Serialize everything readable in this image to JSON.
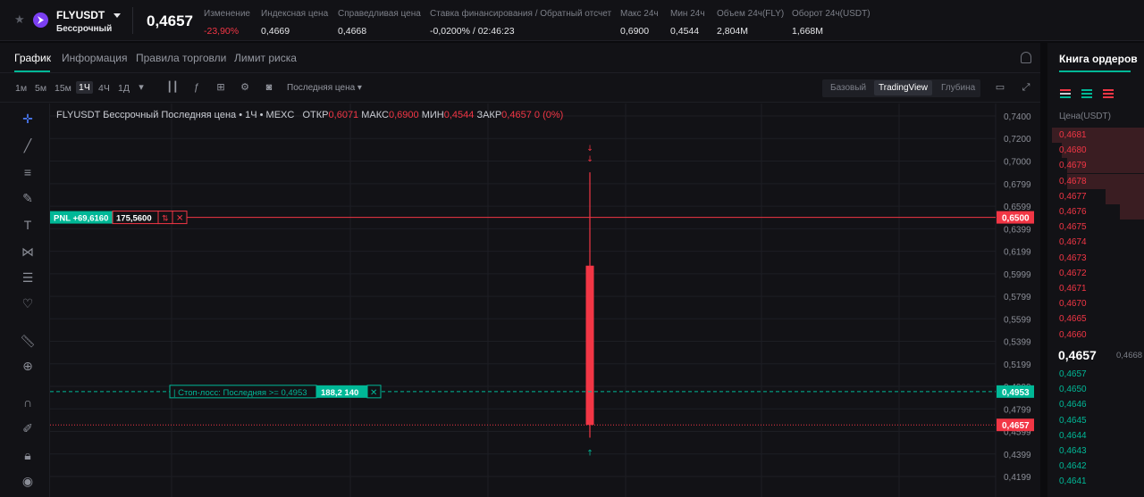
{
  "ticker": {
    "symbol": "FLYUSDT",
    "type": "Бессрочный",
    "last_price": "0,4657",
    "stats": [
      {
        "label": "Изменение",
        "value": "-23,90%",
        "color": "red"
      },
      {
        "label": "Индексная цена",
        "value": "0,4669"
      },
      {
        "label": "Справедливая цена",
        "value": "0,4668"
      },
      {
        "label": "Ставка финансирования / Обратный отсчет",
        "value": "-0,0200% / 02:46:23"
      },
      {
        "label": "Макс 24ч",
        "value": "0,6900"
      },
      {
        "label": "Мин 24ч",
        "value": "0,4544"
      },
      {
        "label": "Объем 24ч(FLY)",
        "value": "2,804M"
      },
      {
        "label": "Оборот 24ч(USDT)",
        "value": "1,668M"
      }
    ]
  },
  "tabs": [
    "График",
    "Информация",
    "Правила торговли",
    "Лимит риска"
  ],
  "toolbar": {
    "timeframes": [
      "1м",
      "5м",
      "15м",
      "1Ч",
      "4Ч",
      "1Д"
    ],
    "active_timeframe": "1Ч",
    "price_source": "Последняя цена",
    "views": [
      "Базовый",
      "TradingView",
      "Глубина"
    ],
    "active_view": "TradingView"
  },
  "legend": {
    "title": "FLYUSDT Бессрочный Последняя цена • 1Ч • MEXC",
    "open_label": "ОТКР",
    "open": "0,6071",
    "high_label": "МАКС",
    "high": "0,6900",
    "low_label": "МИН",
    "low": "0,4544",
    "close_label": "ЗАКР",
    "close": "0,4657",
    "change": "0 (0%)"
  },
  "chart_data": {
    "type": "candlestick",
    "ylim": [
      0.41,
      0.745
    ],
    "y_ticks": [
      "0,7400",
      "0,7200",
      "0,7000",
      "0,6799",
      "0,6599",
      "0,6399",
      "0,6199",
      "0,5999",
      "0,5799",
      "0,5599",
      "0,5399",
      "0,5199",
      "0,4999",
      "0,4799",
      "0,4599",
      "0,4399",
      "0,4199"
    ],
    "y_tick_values": [
      0.74,
      0.72,
      0.7,
      0.6799,
      0.6599,
      0.6399,
      0.6199,
      0.5999,
      0.5799,
      0.5599,
      0.5399,
      0.5199,
      0.4999,
      0.4799,
      0.4599,
      0.4399,
      0.4199
    ],
    "candles": [
      {
        "open": 0.6071,
        "high": 0.69,
        "low": 0.4544,
        "close": 0.4657
      }
    ],
    "price_lines": [
      {
        "name": "position",
        "value": 0.65,
        "label": "0,6500",
        "color": "#f23645"
      },
      {
        "name": "stop-loss",
        "value": 0.4953,
        "label": "0,4953",
        "color": "#00b897"
      },
      {
        "name": "last",
        "value": 0.4657,
        "label": "0,4657",
        "color": "#f23645"
      }
    ],
    "position": {
      "pnl": "PNL +69,6160",
      "qty": "175,5600"
    },
    "stop_loss": {
      "label": "Стоп-лосс: Последняя >= 0,4953",
      "qty": "188,2 140"
    }
  },
  "orderbook": {
    "title": "Книга ордеров",
    "column": "Цена(USDT)",
    "asks": [
      {
        "price": "0,4681",
        "depth": 0.95
      },
      {
        "price": "0,4680",
        "depth": 0.85
      },
      {
        "price": "0,4679",
        "depth": 0.8
      },
      {
        "price": "0,4678",
        "depth": 0.8
      },
      {
        "price": "0,4677",
        "depth": 0.4
      },
      {
        "price": "0,4676",
        "depth": 0.25
      },
      {
        "price": "0,4675",
        "depth": 0
      },
      {
        "price": "0,4674",
        "depth": 0
      },
      {
        "price": "0,4673",
        "depth": 0
      },
      {
        "price": "0,4672",
        "depth": 0
      },
      {
        "price": "0,4671",
        "depth": 0
      },
      {
        "price": "0,4670",
        "depth": 0
      },
      {
        "price": "0,4665",
        "depth": 0
      },
      {
        "price": "0,4660",
        "depth": 0
      }
    ],
    "last": "0,4657",
    "fair": "0,4668",
    "bids": [
      "0,4657",
      "0,4650",
      "0,4646",
      "0,4645",
      "0,4644",
      "0,4643",
      "0,4642",
      "0,4641"
    ]
  },
  "colors": {
    "up": "#00b897",
    "down": "#f23645"
  }
}
